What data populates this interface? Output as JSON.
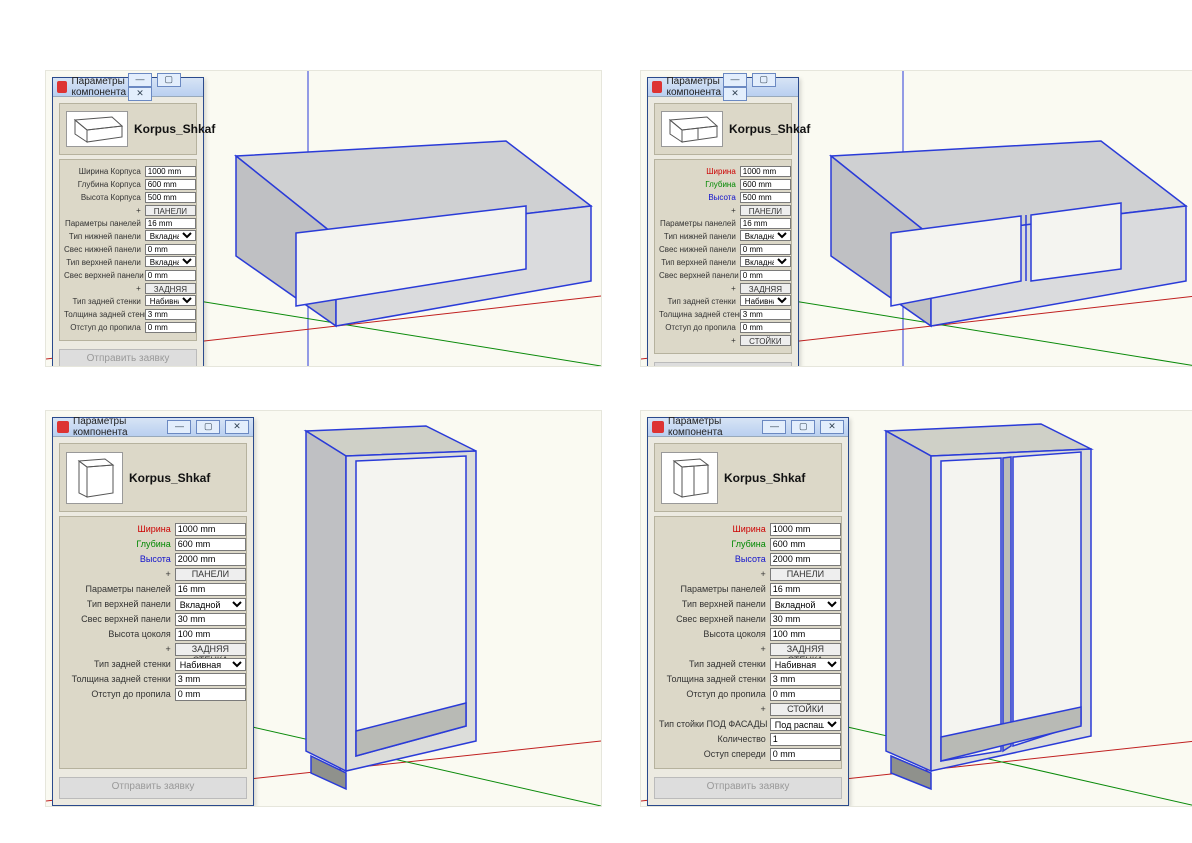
{
  "win": {
    "title": "Параметры компонента",
    "min": "—",
    "max": "▢",
    "close": "✕",
    "submit": "Отправить заявку"
  },
  "comp_title": "Korpus_Shkaf",
  "sec": {
    "panels": "ПАНЕЛИ",
    "back": "ЗАДНЯЯ СТЕНКА",
    "posts": "СТОЙКИ"
  },
  "labels": {
    "width_k": "Ширина Корпуса",
    "depth_k": "Глубина Корпуса",
    "height_k": "Высота Корпуса",
    "width": "Ширина",
    "depth": "Глубина",
    "height": "Высота",
    "panel_params": "Параметры панелей",
    "bottom_type": "Тип нижней панели",
    "bottom_over": "Свес нижней панели",
    "top_type": "Тип верхней панели",
    "top_over": "Свес верхней панели",
    "plinth_h": "Высота цоколя",
    "back_type": "Тип задней стенки",
    "back_th": "Толщина задней стенки",
    "back_off": "Отступ до пропила",
    "post_type": "Тип стойки ПОД ФАСАДЫ",
    "count": "Количество",
    "front_off": "Оступ спереди",
    "plus": "+"
  },
  "opts": {
    "vkladnaya": "Вкладная",
    "vkladnoy": "Вкладной",
    "nabivnaya": "Набивная",
    "pod_rasp": "Под распашные"
  },
  "panel1": {
    "width": "1000 mm",
    "depth": "600 mm",
    "height": "500 mm",
    "panel_th": "16 mm",
    "bot_type": "Вкладная",
    "bot_over": "0 mm",
    "top_type": "Вкладная",
    "top_over": "0 mm",
    "back_type": "Набивная",
    "back_th": "3 mm",
    "back_off": "0 mm"
  },
  "panel2": {
    "width": "1000 mm",
    "depth": "600 mm",
    "height": "500 mm",
    "panel_th": "16 mm",
    "bot_type": "Вкладная",
    "bot_over": "0 mm",
    "top_type": "Вкладная",
    "top_over": "0 mm",
    "back_type": "Набивная",
    "back_th": "3 mm",
    "back_off": "0 mm"
  },
  "panel3": {
    "width": "1000 mm",
    "depth": "600 mm",
    "height": "2000 mm",
    "panel_th": "16 mm",
    "top_type": "Вкладной",
    "top_over": "30 mm",
    "plinth": "100 mm",
    "back_type": "Набивная",
    "back_th": "3 mm",
    "back_off": "0 mm"
  },
  "panel4": {
    "width": "1000 mm",
    "depth": "600 mm",
    "height": "2000 mm",
    "panel_th": "16 mm",
    "top_type": "Вкладной",
    "top_over": "30 mm",
    "plinth": "100 mm",
    "back_type": "Набивная",
    "back_th": "3 mm",
    "back_off": "0 mm",
    "post_type": "Под распашные",
    "count": "1",
    "front_off": "0 mm"
  }
}
